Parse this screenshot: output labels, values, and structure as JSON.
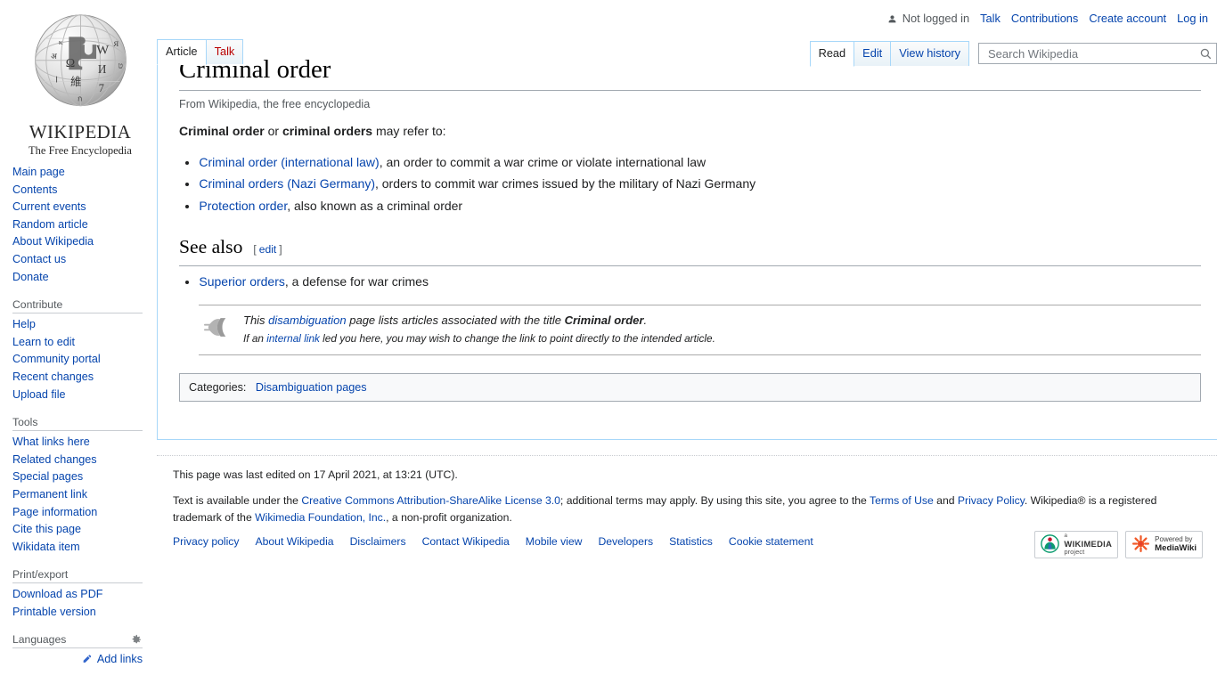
{
  "personal_bar": {
    "user_icon": "user-icon",
    "not_logged_in": "Not logged in",
    "links": [
      {
        "label": "Talk",
        "name": "personal-talk"
      },
      {
        "label": "Contributions",
        "name": "personal-contributions"
      },
      {
        "label": "Create account",
        "name": "personal-create-account"
      },
      {
        "label": "Log in",
        "name": "personal-login"
      }
    ]
  },
  "logo": {
    "wordmark_caps": "W",
    "wordmark_rest": "IKIPEDI",
    "wordmark_last": "A",
    "wordmark": "WIKIPEDIA",
    "tagline": "The Free Encyclopedia"
  },
  "sidebar": {
    "navigation": {
      "items": [
        "Main page",
        "Contents",
        "Current events",
        "Random article",
        "About Wikipedia",
        "Contact us",
        "Donate"
      ]
    },
    "contribute": {
      "heading": "Contribute",
      "items": [
        "Help",
        "Learn to edit",
        "Community portal",
        "Recent changes",
        "Upload file"
      ]
    },
    "tools": {
      "heading": "Tools",
      "items": [
        "What links here",
        "Related changes",
        "Special pages",
        "Permanent link",
        "Page information",
        "Cite this page",
        "Wikidata item"
      ]
    },
    "print_export": {
      "heading": "Print/export",
      "items": [
        "Download as PDF",
        "Printable version"
      ]
    },
    "languages": {
      "heading": "Languages",
      "gear_icon": "gear-icon",
      "add_links": "Add links",
      "pencil_icon": "pencil-icon"
    }
  },
  "tabs": {
    "namespaces": [
      {
        "label": "Article",
        "selected": true,
        "red": false
      },
      {
        "label": "Talk",
        "selected": false,
        "red": true
      }
    ],
    "views": [
      {
        "label": "Read",
        "selected": true
      },
      {
        "label": "Edit",
        "selected": false
      },
      {
        "label": "View history",
        "selected": false
      }
    ]
  },
  "search": {
    "placeholder": "Search Wikipedia",
    "value": "",
    "icon": "search-icon"
  },
  "article": {
    "title": "Criminal order",
    "site_sub": "From Wikipedia, the free encyclopedia",
    "intro": {
      "bold1": "Criminal order",
      "mid": " or ",
      "bold2": "criminal orders",
      "tail": " may refer to:"
    },
    "entries": [
      {
        "link": "Criminal order (international law)",
        "rest": ", an order to commit a war crime or violate international law"
      },
      {
        "link": "Criminal orders (Nazi Germany)",
        "rest": ", orders to commit war crimes issued by the military of Nazi Germany"
      },
      {
        "link": "Protection order",
        "rest": ", also known as a criminal order"
      }
    ],
    "see_also": {
      "heading": "See also",
      "edit_open": "[",
      "edit_label": "edit",
      "edit_close": "]",
      "entries": [
        {
          "link": "Superior orders",
          "rest": ", a defense for war crimes"
        }
      ]
    },
    "dmbox": {
      "icon": "disambiguation-icon",
      "line1_a": "This ",
      "line1_link": "disambiguation",
      "line1_b": " page lists articles associated with the title ",
      "line1_bold": "Criminal order",
      "line1_c": ".",
      "line2_a": "If an ",
      "line2_link": "internal link",
      "line2_b": " led you here, you may wish to change the link to point directly to the intended article."
    },
    "categories": {
      "label": "Categories:",
      "items": [
        "Disambiguation pages"
      ]
    }
  },
  "footer": {
    "last_edited": "This page was last edited on 17 April 2021, at 13:21 (UTC).",
    "license_a": "Text is available under the ",
    "license_link": "Creative Commons Attribution-ShareAlike License 3.0",
    "license_b": "; additional terms may apply. By using this site, you agree to the ",
    "terms_link": "Terms of Use",
    "license_c": " and ",
    "privacy_link": "Privacy Policy",
    "license_d": ". Wikipedia® is a registered trademark of the ",
    "wmf_link": "Wikimedia Foundation, Inc.",
    "license_e": ", a non-profit organization.",
    "places": [
      "Privacy policy",
      "About Wikipedia",
      "Disclaimers",
      "Contact Wikipedia",
      "Mobile view",
      "Developers",
      "Statistics",
      "Cookie statement"
    ],
    "badges": [
      {
        "small": "a",
        "main": "Wikimedia",
        "sub": "project",
        "icon": "wikimedia-icon"
      },
      {
        "small": "",
        "main": "Powered by",
        "sub": "MediaWiki",
        "icon": "mediawiki-icon"
      }
    ]
  },
  "colors": {
    "link": "#0645ad",
    "red_link": "#ba0000",
    "tab_border": "#a7d7f9",
    "rule": "#a2a9b1",
    "muted": "#54595d"
  }
}
